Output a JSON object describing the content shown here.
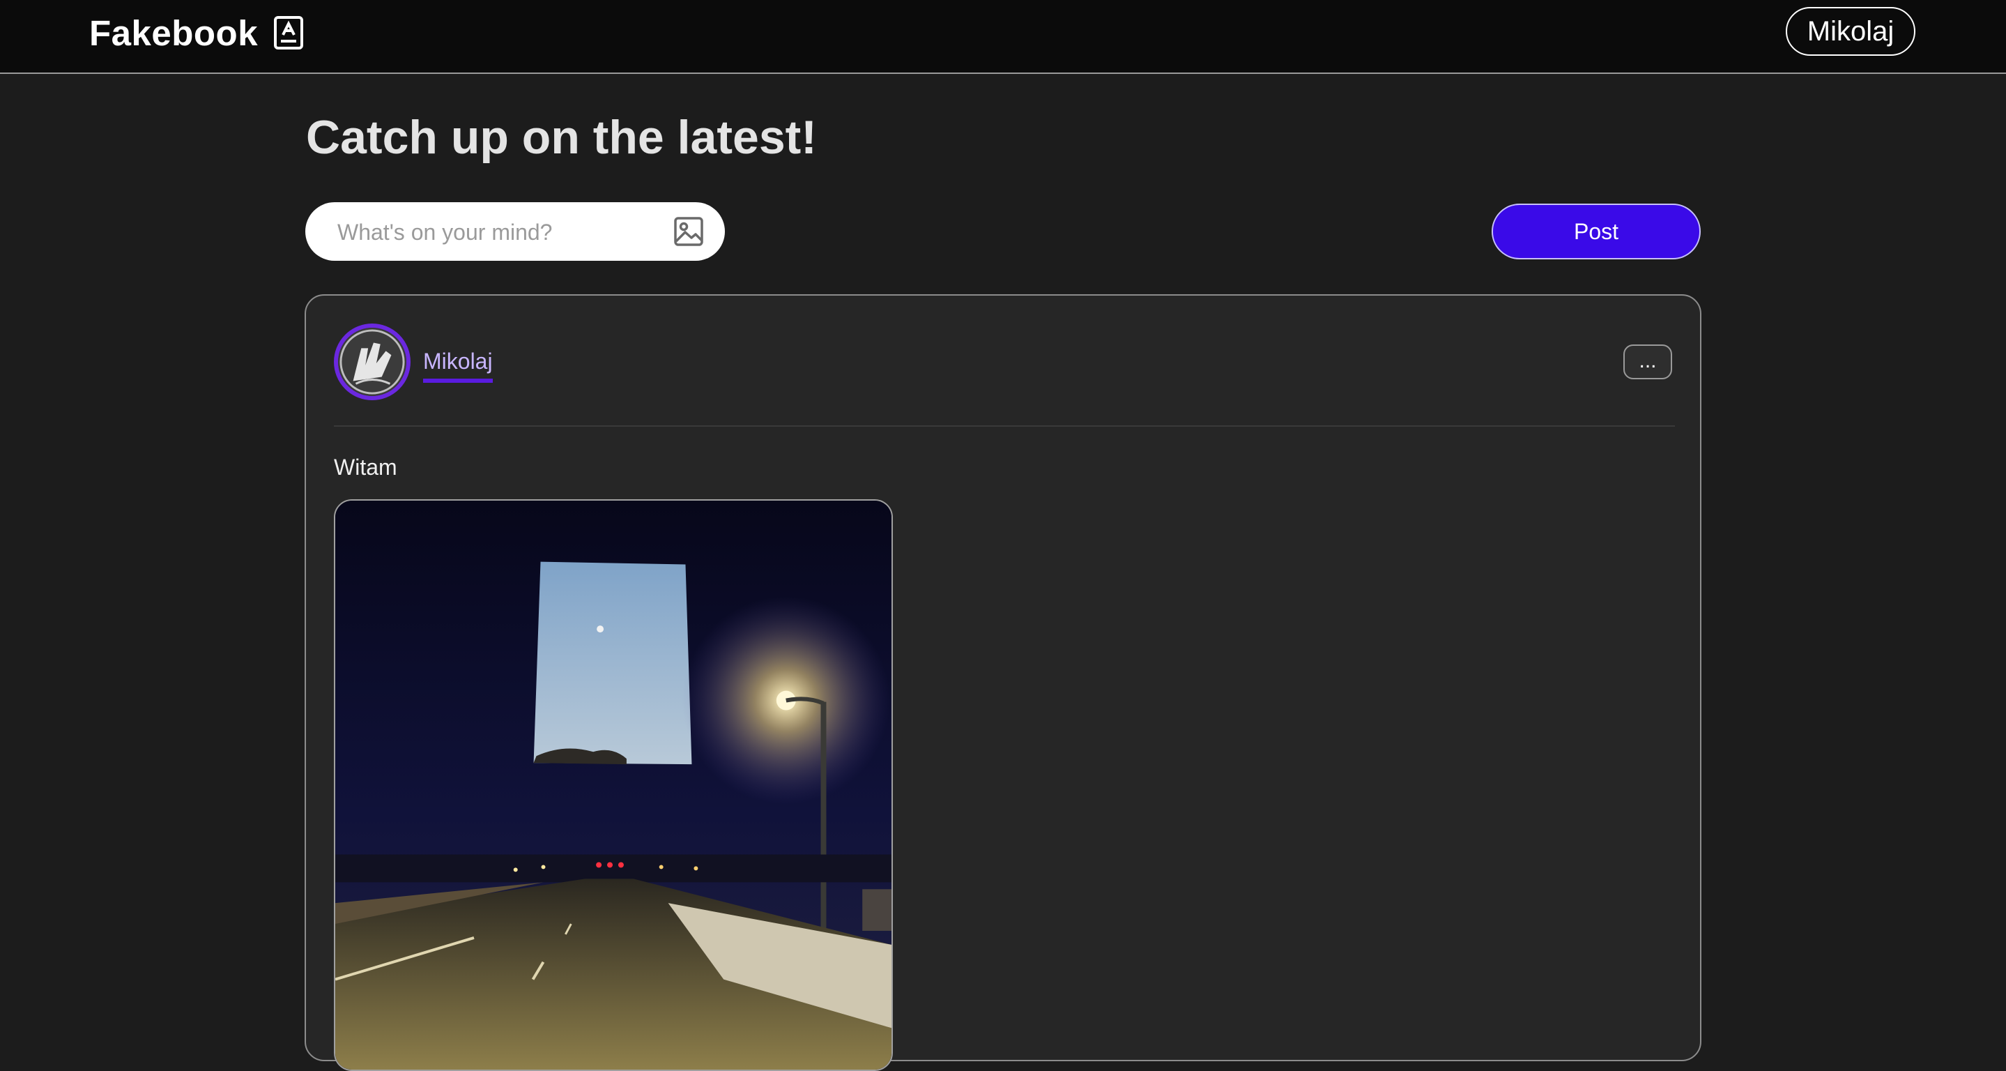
{
  "header": {
    "brand_name": "Fakebook",
    "brand_icon": "profile-book-icon",
    "user_button_label": "Mikolaj"
  },
  "feed": {
    "title": "Catch up on the latest!"
  },
  "composer": {
    "placeholder": "What's on your mind?",
    "value": "",
    "attach_icon": "image-icon",
    "post_button_label": "Post"
  },
  "posts": [
    {
      "author": "Mikolaj",
      "more_label": "...",
      "text": "Witam",
      "image_alt": "photo"
    }
  ],
  "colors": {
    "accent": "#3a0ae8",
    "avatar_ring": "#6b28e0",
    "author_underline": "#5a1be0",
    "background": "#1c1c1c",
    "topbar": "#0b0b0b",
    "card": "#262626"
  }
}
